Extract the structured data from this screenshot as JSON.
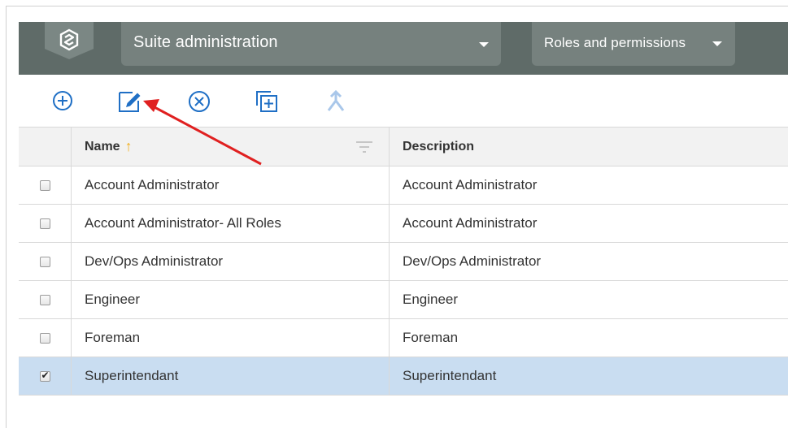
{
  "header": {
    "suite_select": {
      "value": "Suite administration"
    },
    "page_select": {
      "value": "Roles and permissions"
    }
  },
  "toolbar": {
    "icons": [
      "add-icon",
      "edit-icon",
      "remove-icon",
      "duplicate-icon",
      "merge-icon"
    ],
    "accent_color": "#1f6fc5",
    "disabled_color": "#a9c7ea"
  },
  "table": {
    "columns": [
      "Name",
      "Description"
    ],
    "sort_column": "Name",
    "sort_direction": "ascending",
    "rows": [
      {
        "name": "Account Administrator",
        "description": "Account Administrator",
        "checked": false
      },
      {
        "name": "Account Administrator- All Roles",
        "description": "Account Administrator",
        "checked": false
      },
      {
        "name": "Dev/Ops Administrator",
        "description": "Dev/Ops Administrator",
        "checked": false
      },
      {
        "name": "Engineer",
        "description": "Engineer",
        "checked": false
      },
      {
        "name": "Foreman",
        "description": "Foreman",
        "checked": false
      },
      {
        "name": "Superintendant",
        "description": "Superintendant",
        "checked": true
      }
    ],
    "selected_row_color": "#c9ddf1"
  },
  "annotation": {
    "type": "arrow",
    "color": "#e02020",
    "points_to": "edit-icon"
  }
}
